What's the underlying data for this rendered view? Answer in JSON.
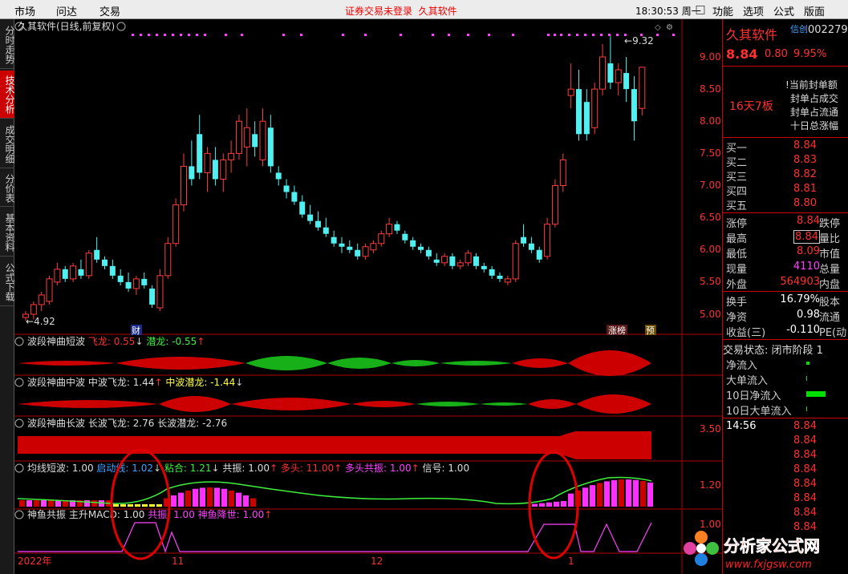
{
  "menu": {
    "left": [
      "市场",
      "问达",
      "交易"
    ],
    "login_warning": "证券交易未登录",
    "brand": "久其软件",
    "clock": "18:30:53 周一",
    "right": [
      "功能",
      "选项",
      "公式",
      "版面"
    ]
  },
  "vtabs": [
    "分时走势",
    "技术分析",
    "成交明细",
    "分价表",
    "基本资料",
    "公式下载"
  ],
  "chart_header": {
    "title": "久其软件(日线,前复权)"
  },
  "price_axis": [
    "9.00",
    "8.50",
    "8.00",
    "7.50",
    "7.00",
    "6.50",
    "6.00",
    "5.50",
    "5.00"
  ],
  "annotations": {
    "high": "9.32",
    "low": "4.92",
    "badge_cai": "财",
    "badge_zhangbang": "涨榜",
    "badge_yu": "预"
  },
  "indicators": {
    "short": {
      "name": "波段神曲短波",
      "fei_label": "飞龙:",
      "fei": "0.55",
      "qian_label": "潜龙:",
      "qian": "-0.55"
    },
    "mid": {
      "name": "波段神曲中波",
      "fei_label": "中波飞龙:",
      "fei": "1.44",
      "qian_label": "中波潜龙:",
      "qian": "-1.44"
    },
    "long": {
      "name": "波段神曲长波",
      "fei_label": "长波飞龙:",
      "fei": "2.76",
      "qian_label": "长波潜龙:",
      "qian": "-2.76",
      "axis": "3.50"
    },
    "jx": {
      "name": "均线短波",
      "v0": ": 1.00",
      "qd_label": "启动线:",
      "qd": "1.02",
      "nh_label": "粘合:",
      "nh": "1.21",
      "gz_label": "共振:",
      "gz": "1.00",
      "dt_label": "多头:",
      "dt": "11.00",
      "dtgz_label": "多头共振:",
      "dtgz": "1.00",
      "xh_label": "信号:",
      "xh": "1.00",
      "axis": "1.20"
    },
    "sy": {
      "name": "神鱼共振",
      "zs_label": "主升MACD:",
      "zs": "1.00",
      "gz_label": "共振:",
      "gz": "1.00",
      "jt_label": "神鱼降世:",
      "jt": "1.00",
      "axis": "1.00"
    }
  },
  "date_axis": [
    "2022年",
    "11",
    "12",
    "1"
  ],
  "panel": {
    "name": "久其软件",
    "xinchuang": "信创",
    "code": "002279",
    "price": "8.84",
    "change": "0.80",
    "pct": "9.95%",
    "boards": "16天7板",
    "seal_items": [
      "当前封单额",
      "封单占成交",
      "封单占流通",
      "十日总涨幅"
    ],
    "bids": [
      {
        "label": "买一",
        "price": "8.84"
      },
      {
        "label": "买二",
        "price": "8.83"
      },
      {
        "label": "买三",
        "price": "8.82"
      },
      {
        "label": "买四",
        "price": "8.81"
      },
      {
        "label": "买五",
        "price": "8.80"
      }
    ],
    "stats1": [
      {
        "label": "涨停",
        "value": "8.84",
        "label2": "跌停"
      },
      {
        "label": "最高",
        "value": "8.84",
        "label2": "量比"
      },
      {
        "label": "最低",
        "value": "8.09",
        "label2": "市值"
      },
      {
        "label": "现量",
        "value": "4110",
        "label2": "总量"
      },
      {
        "label": "外盘",
        "value": "564903",
        "label2": "内盘"
      }
    ],
    "stats2": [
      {
        "label": "换手",
        "value": "16.79%",
        "label2": "股本"
      },
      {
        "label": "净资",
        "value": "0.98",
        "label2": "流通"
      },
      {
        "label": "收益(三)",
        "value": "-0.110",
        "label2": "PE(动"
      }
    ],
    "status": "交易状态: 闭市阶段 1",
    "flows": [
      "净流入",
      "大单流入",
      "10日净流入",
      "10日大单流入"
    ],
    "tick_time": "14:56",
    "ticks": [
      "8.84",
      "8.84",
      "8.84",
      "8.84",
      "8.84",
      "8.84",
      "8.84",
      "8.84"
    ]
  },
  "watermark": {
    "name": "分析家公式网",
    "url": "www.fxjgsw.com"
  },
  "chart_data": {
    "type": "candlestick",
    "title": "久其软件(日线,前复权)",
    "ylim": [
      4.8,
      9.5
    ],
    "candles": [
      [
        4.95,
        5.05,
        4.9,
        5.0
      ],
      [
        5.0,
        5.2,
        4.92,
        5.15
      ],
      [
        5.15,
        5.35,
        5.05,
        5.3
      ],
      [
        5.2,
        5.6,
        5.15,
        5.55
      ],
      [
        5.5,
        5.8,
        5.45,
        5.7
      ],
      [
        5.7,
        5.75,
        5.5,
        5.55
      ],
      [
        5.55,
        5.8,
        5.5,
        5.75
      ],
      [
        5.7,
        5.85,
        5.55,
        5.6
      ],
      [
        5.6,
        6.0,
        5.55,
        5.95
      ],
      [
        6.0,
        6.2,
        5.8,
        5.85
      ],
      [
        5.85,
        5.9,
        5.7,
        5.75
      ],
      [
        5.75,
        5.85,
        5.55,
        5.6
      ],
      [
        5.6,
        5.7,
        5.45,
        5.5
      ],
      [
        5.5,
        5.65,
        5.35,
        5.4
      ],
      [
        5.4,
        5.6,
        5.3,
        5.55
      ],
      [
        5.55,
        5.65,
        5.4,
        5.45
      ],
      [
        5.4,
        5.45,
        5.1,
        5.15
      ],
      [
        5.1,
        5.7,
        5.05,
        5.6
      ],
      [
        5.6,
        6.2,
        5.55,
        6.1
      ],
      [
        6.1,
        6.8,
        6.05,
        6.7
      ],
      [
        6.7,
        7.5,
        6.6,
        7.3
      ],
      [
        7.3,
        7.7,
        7.0,
        7.1
      ],
      [
        7.8,
        8.1,
        7.1,
        7.2
      ],
      [
        7.2,
        7.6,
        6.9,
        7.5
      ],
      [
        7.4,
        7.6,
        7.0,
        7.1
      ],
      [
        7.1,
        7.5,
        6.9,
        7.4
      ],
      [
        7.4,
        7.7,
        7.2,
        7.5
      ],
      [
        7.5,
        8.1,
        7.4,
        8.0
      ],
      [
        7.6,
        8.2,
        7.3,
        7.9
      ],
      [
        7.8,
        8.0,
        7.45,
        7.6
      ],
      [
        7.4,
        8.2,
        7.3,
        8.0
      ],
      [
        7.9,
        8.1,
        7.2,
        7.3
      ],
      [
        7.2,
        7.3,
        7.0,
        7.1
      ],
      [
        7.0,
        7.1,
        6.8,
        6.9
      ],
      [
        6.9,
        7.0,
        6.7,
        6.75
      ],
      [
        6.75,
        6.85,
        6.5,
        6.55
      ],
      [
        6.55,
        6.7,
        6.4,
        6.45
      ],
      [
        6.45,
        6.6,
        6.3,
        6.35
      ],
      [
        6.35,
        6.5,
        6.2,
        6.25
      ],
      [
        6.2,
        6.3,
        6.05,
        6.1
      ],
      [
        6.1,
        6.2,
        5.95,
        6.05
      ],
      [
        6.05,
        6.15,
        5.95,
        6.0
      ],
      [
        6.0,
        6.1,
        5.85,
        5.9
      ],
      [
        5.9,
        6.1,
        5.85,
        6.05
      ],
      [
        6.0,
        6.15,
        5.95,
        6.1
      ],
      [
        6.1,
        6.3,
        6.05,
        6.25
      ],
      [
        6.25,
        6.5,
        6.2,
        6.4
      ],
      [
        6.4,
        6.45,
        6.25,
        6.3
      ],
      [
        6.25,
        6.3,
        6.1,
        6.15
      ],
      [
        6.15,
        6.2,
        6.0,
        6.05
      ],
      [
        6.05,
        6.1,
        5.95,
        6.0
      ],
      [
        6.0,
        6.05,
        5.85,
        5.9
      ],
      [
        5.85,
        5.95,
        5.75,
        5.8
      ],
      [
        5.8,
        5.95,
        5.75,
        5.9
      ],
      [
        5.9,
        5.95,
        5.7,
        5.75
      ],
      [
        5.75,
        5.85,
        5.7,
        5.8
      ],
      [
        5.8,
        6.0,
        5.75,
        5.95
      ],
      [
        5.9,
        5.95,
        5.7,
        5.75
      ],
      [
        5.75,
        5.8,
        5.65,
        5.7
      ],
      [
        5.7,
        5.75,
        5.55,
        5.6
      ],
      [
        5.6,
        5.65,
        5.5,
        5.55
      ],
      [
        5.5,
        5.6,
        5.45,
        5.55
      ],
      [
        5.55,
        6.15,
        5.5,
        6.1
      ],
      [
        6.2,
        6.4,
        6.05,
        6.1
      ],
      [
        6.1,
        6.2,
        5.95,
        6.0
      ],
      [
        6.0,
        6.05,
        5.8,
        5.85
      ],
      [
        5.9,
        6.5,
        5.85,
        6.4
      ],
      [
        6.4,
        7.1,
        6.35,
        7.0
      ],
      [
        7.0,
        7.5,
        6.9,
        7.4
      ],
      [
        8.4,
        8.9,
        8.2,
        8.5
      ],
      [
        8.5,
        8.8,
        7.7,
        7.8
      ],
      [
        8.3,
        8.5,
        7.7,
        7.8
      ],
      [
        7.9,
        8.6,
        7.8,
        8.5
      ],
      [
        8.5,
        9.2,
        8.4,
        9.0
      ],
      [
        8.9,
        9.32,
        8.5,
        8.6
      ],
      [
        8.6,
        8.9,
        8.4,
        8.8
      ],
      [
        8.75,
        9.0,
        8.3,
        8.5
      ],
      [
        8.5,
        8.7,
        7.7,
        8.0
      ],
      [
        8.2,
        8.84,
        8.09,
        8.84
      ]
    ]
  }
}
